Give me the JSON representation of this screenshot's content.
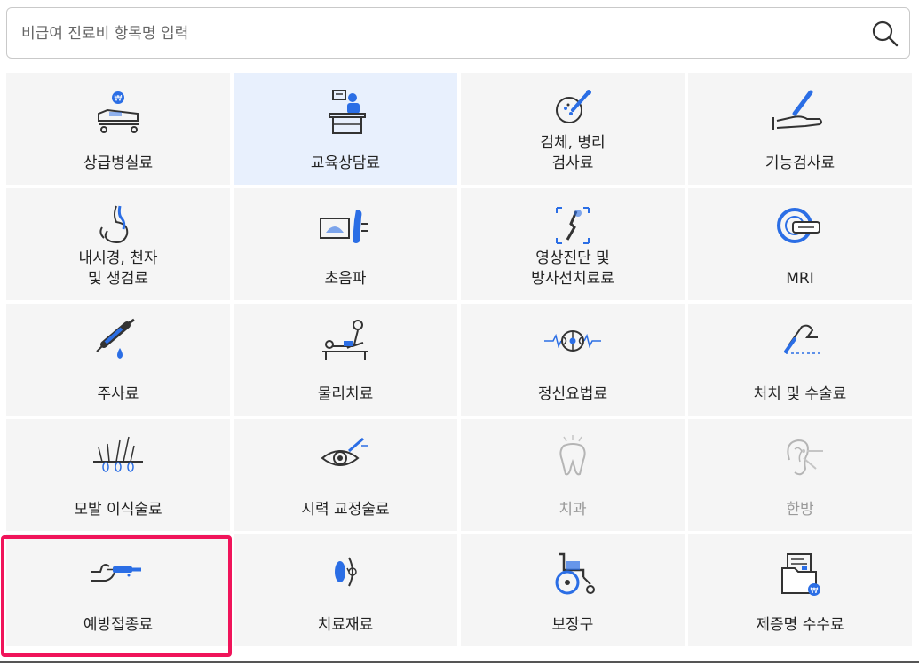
{
  "search": {
    "placeholder": "비급여 진료비 항목명 입력",
    "icon": "search-icon"
  },
  "accent_color": "#2b6ee5",
  "highlight_color": "#f0145a",
  "selected_item": "교육상담료",
  "highlighted_item": "예방접종료",
  "items": [
    {
      "label": "상급병실료",
      "icon": "hospital-bed-icon"
    },
    {
      "label": "교육상담료",
      "icon": "consultation-desk-icon"
    },
    {
      "label": "검체, 병리\n검사료",
      "icon": "lab-specimen-icon"
    },
    {
      "label": "기능검사료",
      "icon": "function-test-icon"
    },
    {
      "label": "내시경, 천자\n및 생검료",
      "icon": "endoscopy-icon"
    },
    {
      "label": "초음파",
      "icon": "ultrasound-icon"
    },
    {
      "label": "영상진단 및\n방사선치료료",
      "icon": "radiology-icon"
    },
    {
      "label": "MRI",
      "icon": "mri-scanner-icon"
    },
    {
      "label": "주사료",
      "icon": "syringe-icon"
    },
    {
      "label": "물리치료",
      "icon": "physical-therapy-icon"
    },
    {
      "label": "정신요법료",
      "icon": "brain-wave-icon"
    },
    {
      "label": "처치 및 수술료",
      "icon": "surgery-hand-icon"
    },
    {
      "label": "모발 이식술료",
      "icon": "hair-transplant-icon"
    },
    {
      "label": "시력 교정술료",
      "icon": "eye-laser-icon"
    },
    {
      "label": "치과",
      "icon": "tooth-icon"
    },
    {
      "label": "한방",
      "icon": "acupuncture-ear-icon"
    },
    {
      "label": "예방접종료",
      "icon": "vaccination-arm-icon"
    },
    {
      "label": "치료재료",
      "icon": "lens-material-icon"
    },
    {
      "label": "보장구",
      "icon": "wheelchair-icon"
    },
    {
      "label": "제증명 수수료",
      "icon": "certificate-folder-icon"
    }
  ]
}
